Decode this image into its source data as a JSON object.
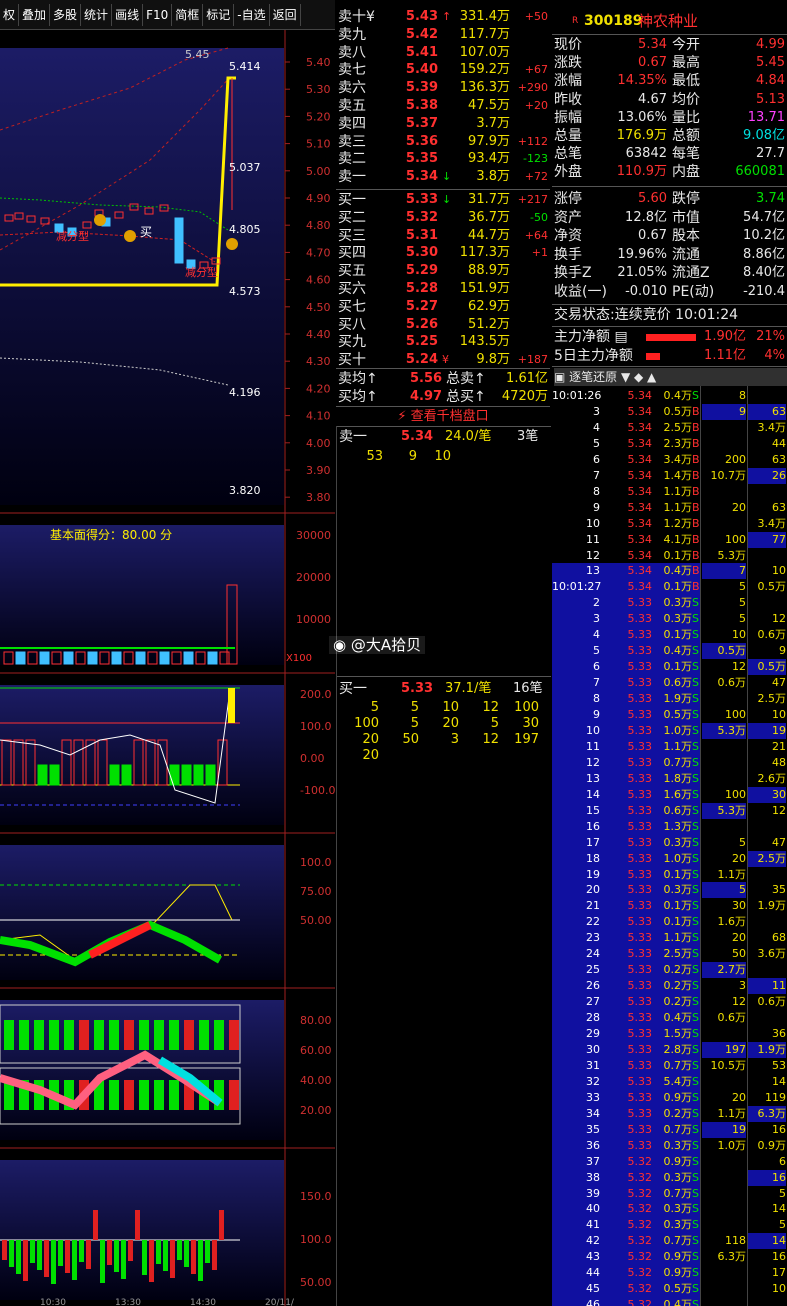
{
  "toolbar": [
    "权",
    "叠加",
    "多股",
    "统计",
    "画线",
    "F10",
    "简框",
    "标记",
    "-自选",
    "返回"
  ],
  "chart": {
    "price_axis": [
      "5.40",
      "5.30",
      "5.20",
      "5.10",
      "5.00",
      "4.90",
      "4.80",
      "4.70",
      "4.60",
      "4.50",
      "4.40",
      "4.30",
      "4.20",
      "4.10",
      "4.00",
      "3.90",
      "3.80"
    ],
    "annot_high": "5.45",
    "annot_5414": "5.414",
    "annot_5037": "5.037",
    "annot_4805": "4.805",
    "annot_4573": "4.573",
    "annot_4196": "4.196",
    "annot_3820": "3.820",
    "annot_buy": "买",
    "annot_sell1": "减分型",
    "annot_sell2": "减分型",
    "score_label": "基本面得分：80.00 分",
    "vol_axis": [
      "30000",
      "20000",
      "10000"
    ],
    "vol_unit": "X100",
    "macd_axis": [
      "200.0",
      "100.0",
      "0.00",
      "-100.0"
    ],
    "kd_axis": [
      "100.0",
      "75.00",
      "50.00"
    ],
    "osc_axis": [
      "80.00",
      "60.00",
      "40.00",
      "20.00"
    ],
    "bot_axis": [
      "150.0",
      "100.0",
      "50.00"
    ],
    "time_axis": [
      "10:30",
      "13:30",
      "14:30",
      "20/11/"
    ]
  },
  "orderbook": {
    "asks": [
      {
        "label": "卖十¥",
        "price": "5.43",
        "arrow": "↑",
        "vol": "331.4万",
        "chg": "+50"
      },
      {
        "label": "卖九",
        "price": "5.42",
        "arrow": "",
        "vol": "117.7万",
        "chg": ""
      },
      {
        "label": "卖八",
        "price": "5.41",
        "arrow": "",
        "vol": "107.0万",
        "chg": ""
      },
      {
        "label": "卖七",
        "price": "5.40",
        "arrow": "",
        "vol": "159.2万",
        "chg": "+67"
      },
      {
        "label": "卖六",
        "price": "5.39",
        "arrow": "",
        "vol": "136.3万",
        "chg": "+290"
      },
      {
        "label": "卖五",
        "price": "5.38",
        "arrow": "",
        "vol": "47.5万",
        "chg": "+20"
      },
      {
        "label": "卖四",
        "price": "5.37",
        "arrow": "",
        "vol": "3.7万",
        "chg": ""
      },
      {
        "label": "卖三",
        "price": "5.36",
        "arrow": "",
        "vol": "97.9万",
        "chg": "+112"
      },
      {
        "label": "卖二",
        "price": "5.35",
        "arrow": "",
        "vol": "93.4万",
        "chg": "-123"
      },
      {
        "label": "卖一",
        "price": "5.34",
        "arrow": "↓",
        "vol": "3.8万",
        "chg": "+72"
      }
    ],
    "bids": [
      {
        "label": "买一",
        "price": "5.33",
        "arrow": "↓",
        "vol": "31.7万",
        "chg": "+217"
      },
      {
        "label": "买二",
        "price": "5.32",
        "arrow": "",
        "vol": "36.7万",
        "chg": "-50"
      },
      {
        "label": "买三",
        "price": "5.31",
        "arrow": "",
        "vol": "44.7万",
        "chg": "+64"
      },
      {
        "label": "买四",
        "price": "5.30",
        "arrow": "",
        "vol": "117.3万",
        "chg": "+1"
      },
      {
        "label": "买五",
        "price": "5.29",
        "arrow": "",
        "vol": "88.9万",
        "chg": ""
      },
      {
        "label": "买六",
        "price": "5.28",
        "arrow": "",
        "vol": "151.9万",
        "chg": ""
      },
      {
        "label": "买七",
        "price": "5.27",
        "arrow": "",
        "vol": "62.9万",
        "chg": ""
      },
      {
        "label": "买八",
        "price": "5.26",
        "arrow": "",
        "vol": "51.2万",
        "chg": ""
      },
      {
        "label": "买九",
        "price": "5.25",
        "arrow": "",
        "vol": "143.5万",
        "chg": ""
      },
      {
        "label": "买十",
        "price": "5.24",
        "arrow": "¥",
        "vol": "9.8万",
        "chg": "+187"
      }
    ],
    "avg_sell_label": "卖均",
    "avg_sell": "5.56",
    "total_sell_label": "总卖",
    "total_sell": "1.61亿",
    "avg_buy_label": "买均",
    "avg_buy": "4.97",
    "total_buy_label": "总买",
    "total_buy": "4720万",
    "view_1000": "查看千档盘口",
    "sell1_label": "卖一",
    "sell1_price": "5.34",
    "sell1_per": "24.0/笔",
    "sell1_count": "3笔",
    "sell1_orders": [
      "53",
      "9",
      "10"
    ],
    "buy1_label": "买一",
    "buy1_price": "5.33",
    "buy1_per": "37.1/笔",
    "buy1_count": "16笔",
    "buy1_orders": [
      [
        "5",
        "5",
        "10",
        "12",
        "100"
      ],
      [
        "100",
        "5",
        "20",
        "5",
        "30"
      ],
      [
        "20",
        "50",
        "3",
        "12",
        "197"
      ],
      [
        "20"
      ]
    ],
    "watermark": "@大A拾贝"
  },
  "info": {
    "code": "300189",
    "name": "神农种业",
    "rows": [
      [
        "现价",
        "5.34",
        "今开",
        "4.99"
      ],
      [
        "涨跌",
        "0.67",
        "最高",
        "5.45"
      ],
      [
        "涨幅",
        "14.35%",
        "最低",
        "4.84"
      ],
      [
        "昨收",
        "4.67",
        "均价",
        "5.13"
      ],
      [
        "振幅",
        "13.06%",
        "量比",
        "13.71"
      ],
      [
        "总量",
        "176.9万",
        "总额",
        "9.08亿"
      ],
      [
        "总笔",
        "63842",
        "每笔",
        "27.7"
      ],
      [
        "外盘",
        "110.9万",
        "内盘",
        "660081"
      ]
    ],
    "rows2": [
      [
        "涨停",
        "5.60",
        "跌停",
        "3.74"
      ],
      [
        "资产",
        "12.8亿",
        "市值",
        "54.7亿"
      ],
      [
        "净资",
        "0.67",
        "股本",
        "10.2亿"
      ],
      [
        "换手",
        "19.96%",
        "流通",
        "8.86亿"
      ],
      [
        "换手Z",
        "21.05%",
        "流通Z",
        "8.40亿"
      ],
      [
        "收益(一)",
        "-0.010",
        "PE(动)",
        "-210.4"
      ]
    ],
    "trade_status": "交易状态:连续竞价 10:01:24",
    "main_net_label": "主力净额",
    "main_net": "1.90亿",
    "main_net_pct": "21%",
    "main5_label": "5日主力净额",
    "main5": "1.11亿",
    "main5_pct": "4%",
    "tick_title": "逐笔还原"
  },
  "ticks": [
    [
      "10:01:26",
      "5.34",
      "0.4万",
      "S",
      "8",
      "",
      ""
    ],
    [
      "3",
      "5.34",
      "0.5万",
      "B",
      "9",
      "",
      "63"
    ],
    [
      "4",
      "5.34",
      "2.5万",
      "B",
      "",
      "",
      "3.4万"
    ],
    [
      "5",
      "5.34",
      "2.3万",
      "B",
      "",
      "",
      "44"
    ],
    [
      "6",
      "5.34",
      "3.4万",
      "B",
      "200",
      "",
      "63"
    ],
    [
      "7",
      "5.34",
      "1.4万",
      "B",
      "10.7万",
      "",
      "26"
    ],
    [
      "8",
      "5.34",
      "1.1万",
      "B",
      "",
      "",
      ""
    ],
    [
      "9",
      "5.34",
      "1.1万",
      "B",
      "20",
      "",
      "63"
    ],
    [
      "10",
      "5.34",
      "1.2万",
      "B",
      "",
      "",
      "3.4万"
    ],
    [
      "11",
      "5.34",
      "4.1万",
      "B",
      "100",
      "",
      "77"
    ],
    [
      "12",
      "5.34",
      "0.1万",
      "B",
      "5.3万",
      "",
      ""
    ],
    [
      "13",
      "5.34",
      "0.4万",
      "B",
      "7",
      "",
      "10"
    ],
    [
      "10:01:27",
      "5.34",
      "0.1万",
      "B",
      "5",
      "",
      "0.5万"
    ],
    [
      "2",
      "5.33",
      "0.3万",
      "S",
      "5",
      "",
      ""
    ],
    [
      "3",
      "5.33",
      "0.3万",
      "S",
      "5",
      "",
      "12"
    ],
    [
      "4",
      "5.33",
      "0.1万",
      "S",
      "10",
      "",
      "0.6万"
    ],
    [
      "5",
      "5.33",
      "0.4万",
      "S",
      "0.5万",
      "",
      "9"
    ],
    [
      "6",
      "5.33",
      "0.1万",
      "S",
      "12",
      "",
      "0.5万"
    ],
    [
      "7",
      "5.33",
      "0.6万",
      "S",
      "0.6万",
      "",
      "47"
    ],
    [
      "8",
      "5.33",
      "1.9万",
      "S",
      "",
      "",
      "2.5万"
    ],
    [
      "9",
      "5.33",
      "0.5万",
      "S",
      "100",
      "",
      "10"
    ],
    [
      "10",
      "5.33",
      "1.0万",
      "S",
      "5.3万",
      "",
      "19"
    ],
    [
      "11",
      "5.33",
      "1.1万",
      "S",
      "",
      "",
      "21"
    ],
    [
      "12",
      "5.33",
      "0.7万",
      "S",
      "",
      "",
      "48"
    ],
    [
      "13",
      "5.33",
      "1.8万",
      "S",
      "",
      "",
      "2.6万"
    ],
    [
      "14",
      "5.33",
      "1.6万",
      "S",
      "100",
      "",
      "30"
    ],
    [
      "15",
      "5.33",
      "0.6万",
      "S",
      "5.3万",
      "",
      "12"
    ],
    [
      "16",
      "5.33",
      "1.3万",
      "S",
      "",
      "",
      ""
    ],
    [
      "17",
      "5.33",
      "0.3万",
      "S",
      "5",
      "",
      "47"
    ],
    [
      "18",
      "5.33",
      "1.0万",
      "S",
      "20",
      "",
      "2.5万"
    ],
    [
      "19",
      "5.33",
      "0.1万",
      "S",
      "1.1万",
      "",
      ""
    ],
    [
      "20",
      "5.33",
      "0.3万",
      "S",
      "5",
      "",
      "35"
    ],
    [
      "21",
      "5.33",
      "0.1万",
      "S",
      "30",
      "",
      "1.9万"
    ],
    [
      "22",
      "5.33",
      "0.1万",
      "S",
      "1.6万",
      "",
      ""
    ],
    [
      "23",
      "5.33",
      "1.1万",
      "S",
      "20",
      "",
      "68"
    ],
    [
      "24",
      "5.33",
      "2.5万",
      "S",
      "50",
      "",
      "3.6万"
    ],
    [
      "25",
      "5.33",
      "0.2万",
      "S",
      "2.7万",
      "",
      ""
    ],
    [
      "26",
      "5.33",
      "0.2万",
      "S",
      "3",
      "",
      "11"
    ],
    [
      "27",
      "5.33",
      "0.2万",
      "S",
      "12",
      "",
      "0.6万"
    ],
    [
      "28",
      "5.33",
      "0.4万",
      "S",
      "0.6万",
      "",
      ""
    ],
    [
      "29",
      "5.33",
      "1.5万",
      "S",
      "",
      "",
      "36"
    ],
    [
      "30",
      "5.33",
      "2.8万",
      "S",
      "197",
      "",
      "1.9万"
    ],
    [
      "31",
      "5.33",
      "0.7万",
      "S",
      "10.5万",
      "",
      "53"
    ],
    [
      "32",
      "5.33",
      "5.4万",
      "S",
      "",
      "",
      "14"
    ],
    [
      "33",
      "5.33",
      "0.9万",
      "S",
      "20",
      "",
      "119"
    ],
    [
      "34",
      "5.33",
      "0.2万",
      "S",
      "1.1万",
      "",
      "6.3万"
    ],
    [
      "35",
      "5.33",
      "0.7万",
      "S",
      "19",
      "",
      "16"
    ],
    [
      "36",
      "5.33",
      "0.3万",
      "S",
      "1.0万",
      "",
      "0.9万"
    ],
    [
      "37",
      "5.32",
      "0.9万",
      "S",
      "",
      "",
      "6"
    ],
    [
      "38",
      "5.32",
      "0.3万",
      "S",
      "",
      "",
      "16"
    ],
    [
      "39",
      "5.32",
      "0.7万",
      "S",
      "",
      "",
      "5"
    ],
    [
      "40",
      "5.32",
      "0.3万",
      "S",
      "",
      "",
      "14"
    ],
    [
      "41",
      "5.32",
      "0.3万",
      "S",
      "",
      "",
      "5"
    ],
    [
      "42",
      "5.32",
      "0.7万",
      "S",
      "118",
      "",
      "14"
    ],
    [
      "43",
      "5.32",
      "0.9万",
      "S",
      "6.3万",
      "",
      "16"
    ],
    [
      "44",
      "5.32",
      "0.9万",
      "S",
      "",
      "",
      "17"
    ],
    [
      "45",
      "5.32",
      "0.5万",
      "S",
      "",
      "",
      "10"
    ],
    [
      "46",
      "5.32",
      "0.4万",
      "S",
      "",
      "",
      ""
    ]
  ]
}
